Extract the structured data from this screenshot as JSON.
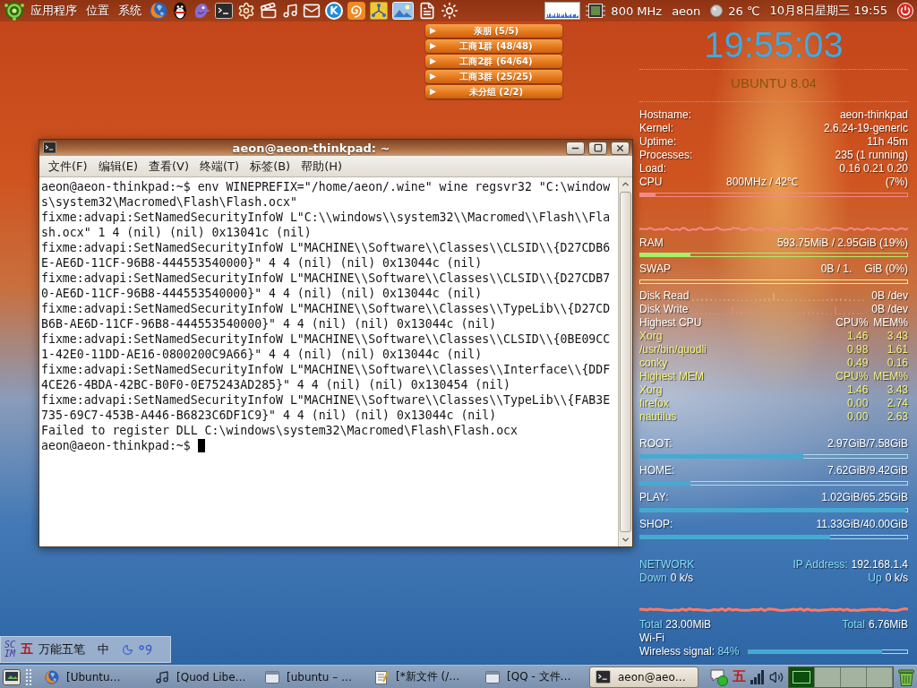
{
  "top_panel": {
    "menus": [
      "应用程序",
      "位置",
      "系统"
    ],
    "launchers": [
      {
        "kind": "browser"
      },
      {
        "kind": "penguin"
      },
      {
        "kind": "bird"
      },
      {
        "kind": "terminal"
      },
      {
        "kind": "gear"
      },
      {
        "kind": "clapper"
      },
      {
        "kind": "note"
      },
      {
        "kind": "mail"
      },
      {
        "kind": "letter",
        "label": "K"
      },
      {
        "kind": "swirl"
      },
      {
        "kind": "network"
      },
      {
        "kind": "picture"
      },
      {
        "kind": "document"
      },
      {
        "kind": "sun"
      }
    ],
    "cpu_frequency": "800 MHz",
    "user": "aeon",
    "temperature": "26 ℃",
    "clock": "10月8日星期三 19:55"
  },
  "qq_groups": [
    {
      "label": "亲朋 (5/5)",
      "expanded": false
    },
    {
      "label": "工商1群 (48/48)",
      "expanded": false
    },
    {
      "label": "工商2群 (64/64)",
      "expanded": false
    },
    {
      "label": "工商3群 (25/25)",
      "expanded": false
    },
    {
      "label": "未分组 (2/2)",
      "expanded": false
    }
  ],
  "terminal": {
    "title": "aeon@aeon-thinkpad: ~",
    "menu": [
      "文件(F)",
      "编辑(E)",
      "查看(V)",
      "终端(T)",
      "标签(B)",
      "帮助(H)"
    ],
    "lines": [
      "aeon@aeon-thinkpad:~$ env WINEPREFIX=\"/home/aeon/.wine\" wine regsvr32 \"C:\\window",
      "s\\system32\\Macromed\\Flash\\Flash.ocx\"",
      "fixme:advapi:SetNamedSecurityInfoW L\"C:\\\\windows\\\\system32\\\\Macromed\\\\Flash\\\\Fla",
      "sh.ocx\" 1 4 (nil) (nil) 0x13041c (nil)",
      "fixme:advapi:SetNamedSecurityInfoW L\"MACHINE\\\\Software\\\\Classes\\\\CLSID\\\\{D27CDB6",
      "E-AE6D-11CF-96B8-444553540000}\" 4 4 (nil) (nil) 0x13044c (nil)",
      "fixme:advapi:SetNamedSecurityInfoW L\"MACHINE\\\\Software\\\\Classes\\\\CLSID\\\\{D27CDB7",
      "0-AE6D-11CF-96B8-444553540000}\" 4 4 (nil) (nil) 0x13044c (nil)",
      "fixme:advapi:SetNamedSecurityInfoW L\"MACHINE\\\\Software\\\\Classes\\\\TypeLib\\\\{D27CD",
      "B6B-AE6D-11CF-96B8-444553540000}\" 4 4 (nil) (nil) 0x13044c (nil)",
      "fixme:advapi:SetNamedSecurityInfoW L\"MACHINE\\\\Software\\\\Classes\\\\CLSID\\\\{0BE09CC",
      "1-42E0-11DD-AE16-0800200C9A66}\" 4 4 (nil) (nil) 0x13044c (nil)",
      "fixme:advapi:SetNamedSecurityInfoW L\"MACHINE\\\\Software\\\\Classes\\\\Interface\\\\{DDF",
      "4CE26-4BDA-42BC-B0F0-0E75243AD285}\" 4 4 (nil) (nil) 0x130454 (nil)",
      "fixme:advapi:SetNamedSecurityInfoW L\"MACHINE\\\\Software\\\\Classes\\\\TypeLib\\\\{FAB3E",
      "735-69C7-453B-A446-B6823C6DF1C9}\" 4 4 (nil) (nil) 0x13044c (nil)",
      "Failed to register DLL C:\\windows\\system32\\Macromed\\Flash\\Flash.ocx"
    ],
    "prompt": "aeon@aeon-thinkpad:~$"
  },
  "conky": {
    "clock": "19:55:03",
    "distro": "UBUNTU 8.04",
    "info": [
      {
        "label": "Hostname:",
        "value": "aeon-thinkpad"
      },
      {
        "label": "Kernel:",
        "value": "2.6.24-19-generic"
      },
      {
        "label": "Uptime:",
        "value": "11h 45m"
      },
      {
        "label": "Processes:",
        "value": "235 (1 running)"
      },
      {
        "label": "Load:",
        "value": "0.16 0.21 0.20"
      }
    ],
    "cpu": {
      "label": "CPU",
      "detail": "800MHz / 42℃",
      "value": "(7%)",
      "level": 0.06
    },
    "memory": [
      {
        "label": "RAM",
        "value": "593.75MiB / 2.95GiB (19%)",
        "level": 0.19,
        "color": "#a6f06a"
      },
      {
        "label": "SWAP",
        "value": "0B / 1.",
        "value_tail": "GiB (0%)",
        "level": 0,
        "color": "#f4ee82"
      }
    ],
    "disk": [
      {
        "label": "Disk Read",
        "value": "0B /dev"
      },
      {
        "label": "Disk Write",
        "value": "0B /dev"
      }
    ],
    "processes": [
      {
        "kind": "cpu",
        "title": "Highest CPU",
        "columns": [
          "CPU%",
          "MEM%"
        ],
        "rows": [
          {
            "name": "Xorg",
            "cpu": "1.46",
            "mem": "3.43"
          },
          {
            "name": "/usr/bin/quodli",
            "cpu": "0.98",
            "mem": "1.61"
          },
          {
            "name": "conky",
            "cpu": "0.49",
            "mem": "0.16"
          }
        ]
      },
      {
        "kind": "mem",
        "title": "Highest MEM",
        "columns": [
          "CPU%",
          "MEM%"
        ],
        "rows": [
          {
            "name": "Xorg",
            "cpu": "1.46",
            "mem": "3.43"
          },
          {
            "name": "firefox",
            "cpu": "0.00",
            "mem": "2.74"
          },
          {
            "name": "nautilus",
            "cpu": "0.00",
            "mem": "2.63"
          }
        ]
      }
    ],
    "filesystems": [
      {
        "label": "ROOT:",
        "value": "2.97GiB/7.58GiB",
        "level": 0.61
      },
      {
        "label": "HOME:",
        "value": "7.62GiB/9.42GiB",
        "level": 0.19
      },
      {
        "label": "PLAY:",
        "value": "1.02GiB/65.25GiB",
        "level": 0.99
      },
      {
        "label": "SHOP:",
        "value": "11.33GiB/40.00GiB",
        "level": 0.71
      }
    ],
    "network": {
      "title": "NETWORK",
      "ip_label": "IP Address:",
      "ip": "192.168.1.4",
      "down_label": "Down",
      "down": "0 k/s",
      "up_label": "Up",
      "up": "0 k/s",
      "down_total_label": "Total",
      "down_total": "23.00MiB",
      "up_total_label": "Total",
      "up_total": "6.76MiB"
    },
    "wifi": {
      "title": "Wi-Fi",
      "signal_label": "Wireless signal:",
      "signal": "84%",
      "level": 0.84
    }
  },
  "ime_bar": {
    "logo": "SCIM",
    "method_glyph": "五",
    "method": "万能五笔",
    "mode": "中"
  },
  "taskbar": {
    "tasks": [
      {
        "kind": "browser",
        "label": "[Ubuntu…",
        "selected": false
      },
      {
        "kind": "note",
        "label": "[Quod Libe…",
        "selected": false
      },
      {
        "kind": "window",
        "label": "[ubuntu – …",
        "selected": false
      },
      {
        "kind": "editor",
        "label": "[*新文件 (/…",
        "selected": false
      },
      {
        "kind": "window",
        "label": "[QQ - 文件…",
        "selected": false
      },
      {
        "kind": "terminal",
        "label": "aeon@aeo…",
        "selected": true
      }
    ],
    "tray_glyph": "五",
    "workspaces": [
      {
        "selected": true
      },
      {
        "selected": false
      },
      {
        "selected": false
      },
      {
        "selected": false
      }
    ]
  }
}
